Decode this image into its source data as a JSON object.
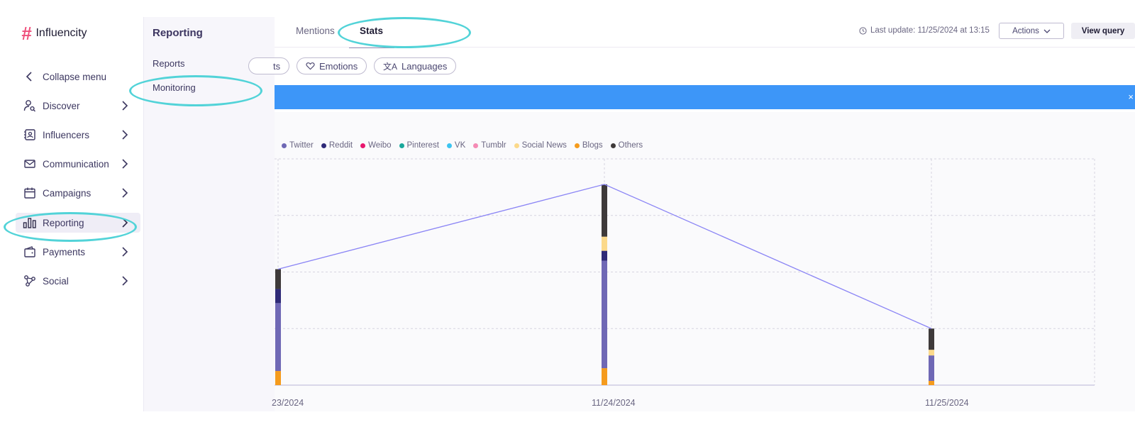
{
  "app": {
    "name": "Influencity"
  },
  "sidebar": {
    "items": [
      {
        "label": "Collapse menu",
        "icon": "chevron-left-icon"
      },
      {
        "label": "Discover",
        "icon": "user-search-icon"
      },
      {
        "label": "Influencers",
        "icon": "contact-card-icon"
      },
      {
        "label": "Communication",
        "icon": "envelope-icon"
      },
      {
        "label": "Campaigns",
        "icon": "calendar-icon"
      },
      {
        "label": "Reporting",
        "icon": "bar-chart-icon"
      },
      {
        "label": "Payments",
        "icon": "wallet-icon"
      },
      {
        "label": "Social",
        "icon": "network-icon"
      }
    ]
  },
  "submenu": {
    "title": "Reporting",
    "items": [
      {
        "label": "Reports"
      },
      {
        "label": "Monitoring"
      }
    ]
  },
  "header": {
    "tabs": [
      {
        "label": "Mentions"
      },
      {
        "label": "Stats",
        "active": true
      }
    ],
    "last_update": "Last update: 11/25/2024 at 13:15",
    "actions_label": "Actions",
    "view_query_label": "View query"
  },
  "filters": [
    {
      "label": "ts",
      "icon": ""
    },
    {
      "label": "Emotions",
      "icon": "heart-icon"
    },
    {
      "label": "Languages",
      "icon": "translate-icon"
    }
  ],
  "banner": {
    "close": "×",
    "color": "#3d96f8"
  },
  "chart_data": {
    "type": "bar",
    "categories": [
      "23/2024",
      "11/24/2024",
      "11/25/2024"
    ],
    "series": [
      {
        "name": "Twitter",
        "color": "#6f68b5",
        "values": [
          24,
          38,
          9
        ]
      },
      {
        "name": "Reddit",
        "color": "#2f2a78",
        "values": [
          5,
          3.5,
          0
        ]
      },
      {
        "name": "Weibo",
        "color": "#e8176e",
        "values": [
          0,
          0,
          0
        ]
      },
      {
        "name": "Pinterest",
        "color": "#1aa89b",
        "values": [
          0,
          0,
          0
        ]
      },
      {
        "name": "VK",
        "color": "#3cc4f0",
        "values": [
          0,
          0,
          0
        ]
      },
      {
        "name": "Tumblr",
        "color": "#f58bb5",
        "values": [
          0,
          0,
          0
        ]
      },
      {
        "name": "Social News",
        "color": "#fbd98b",
        "values": [
          0,
          5,
          2
        ]
      },
      {
        "name": "Blogs",
        "color": "#f59b1d",
        "values": [
          5,
          6,
          1.5
        ]
      },
      {
        "name": "Others",
        "color": "#3e3a3a",
        "values": [
          7,
          18.5,
          7.5
        ]
      }
    ],
    "line": {
      "name": "Total",
      "color": "#8a84f5",
      "values": [
        41,
        71,
        20
      ]
    },
    "ylim": [
      0,
      80
    ],
    "grid": true,
    "legend_position": "top-left"
  }
}
